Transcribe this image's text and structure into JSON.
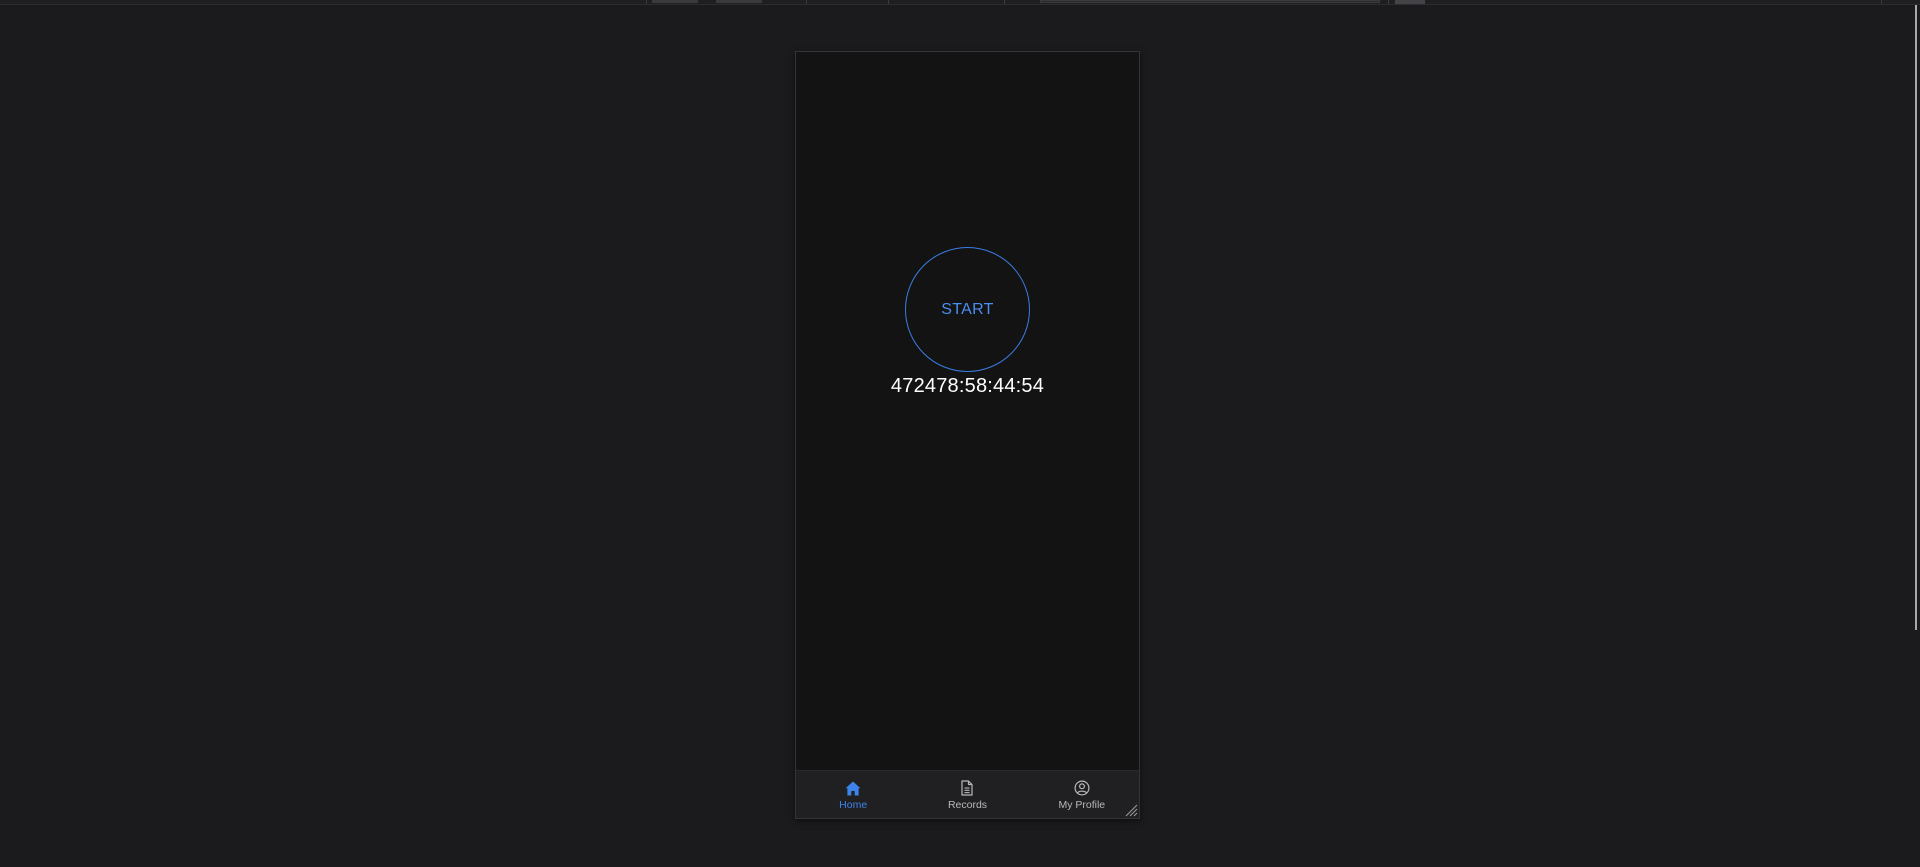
{
  "colors": {
    "background": "#1b1b1d",
    "phone_background": "#131314",
    "accent": "#3d83ec",
    "text": "#ffffff",
    "nav_inactive": "#b8b8bc"
  },
  "main": {
    "start_label": "START",
    "timer": "472478:58:44:54"
  },
  "bottom_nav": {
    "items": [
      {
        "label": "Home",
        "icon": "home-icon",
        "active": true
      },
      {
        "label": "Records",
        "icon": "document-icon",
        "active": false
      },
      {
        "label": "My Profile",
        "icon": "user-circle-icon",
        "active": false
      }
    ]
  }
}
